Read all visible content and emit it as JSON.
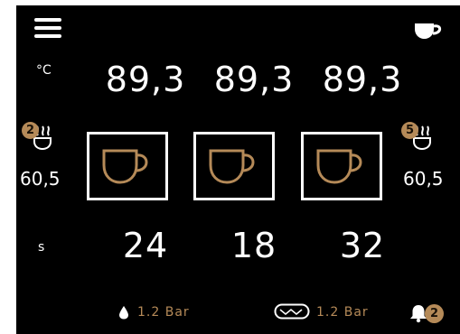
{
  "header": {
    "menu_icon": "menu-icon",
    "mode_icon": "coffee-cup-icon"
  },
  "units": {
    "temperature": "°C",
    "time": "s"
  },
  "groups": [
    {
      "temperature": "89,3",
      "time": "24"
    },
    {
      "temperature": "89,3",
      "time": "18"
    },
    {
      "temperature": "89,3",
      "time": "32"
    }
  ],
  "steam_left": {
    "badge": "2",
    "value": "60,5"
  },
  "steam_right": {
    "badge": "5",
    "value": "60,5"
  },
  "status": {
    "water_pressure": "1.2 Bar",
    "pump_pressure": "1.2 Bar",
    "alerts": "2"
  },
  "colors": {
    "accent": "#b58a58",
    "background": "#000000",
    "text": "#ffffff"
  }
}
